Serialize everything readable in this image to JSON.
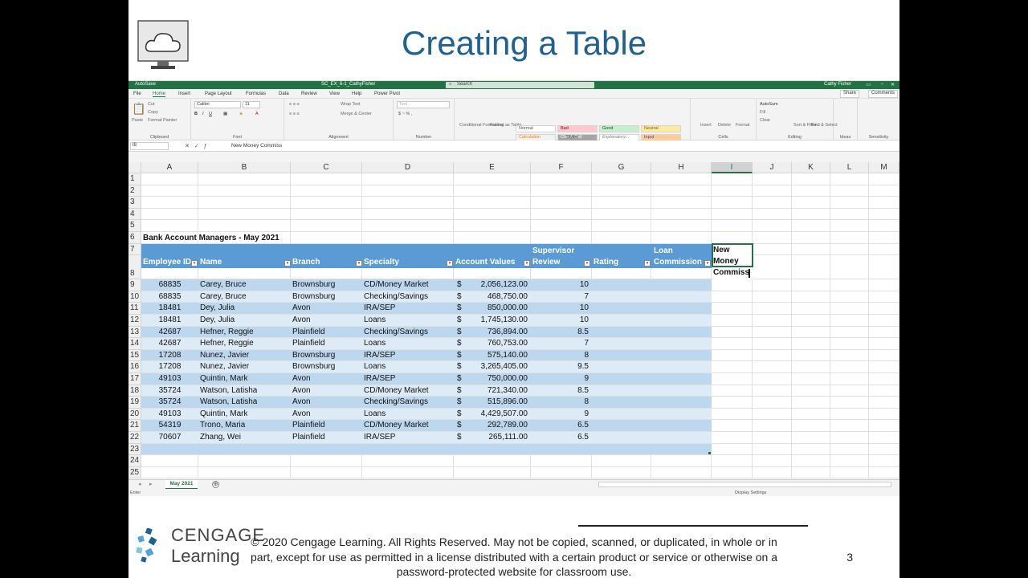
{
  "slide": {
    "title": "Creating a Table",
    "page_number": "3",
    "copyright": "© 2020 Cengage Learning. All Rights Reserved. May not be copied, scanned, or duplicated, in whole or in part, except for use as permitted in a license distributed with a certain product or service or otherwise on a password-protected website for classroom use.",
    "logo_line1": "CENGAGE",
    "logo_line2": "Learning"
  },
  "excel": {
    "titlebar": {
      "autosave": "AutoSave",
      "filename": "SC_EX_6-1_CathyFisher",
      "search": "Search",
      "user": "Cathy Fisher"
    },
    "menu_tabs": [
      "File",
      "Home",
      "Insert",
      "Page Layout",
      "Formulas",
      "Data",
      "Review",
      "View",
      "Help",
      "Power Pivot"
    ],
    "active_tab": "Home",
    "share": "Share",
    "comments": "Comments",
    "ribbon": {
      "clipboard": {
        "label": "Clipboard",
        "paste": "Paste",
        "cut": "Cut",
        "copy": "Copy",
        "format_painter": "Format Painter"
      },
      "font": {
        "label": "Font",
        "font_name": "Calibri",
        "font_size": "11"
      },
      "alignment": {
        "label": "Alignment",
        "wrap_text": "Wrap Text",
        "merge_center": "Merge & Center"
      },
      "number": {
        "label": "Number",
        "format": "Text"
      },
      "styles": {
        "label": "Styles",
        "conditional": "Conditional Formatting",
        "format_as_table": "Format as Table",
        "cell_styles": [
          "Normal",
          "Bad",
          "Good",
          "Neutral",
          "Calculation",
          "Check Cell",
          "Explanatory...",
          "Input"
        ]
      },
      "cells": {
        "label": "Cells",
        "insert": "Insert",
        "delete": "Delete",
        "format": "Format"
      },
      "editing": {
        "label": "Editing",
        "autosum": "AutoSum",
        "fill": "Fill",
        "clear": "Clear",
        "sort_filter": "Sort & Filter",
        "find_select": "Find & Select"
      },
      "ideas": {
        "label": "Ideas"
      },
      "sensitivity": {
        "label": "Sensitivity"
      }
    },
    "name_box": "I8",
    "formula": "New Money Commiss",
    "columns": [
      "A",
      "B",
      "C",
      "D",
      "E",
      "F",
      "G",
      "H",
      "I",
      "J",
      "K",
      "L",
      "M"
    ],
    "rows": [
      "1",
      "2",
      "3",
      "4",
      "5",
      "6",
      "7",
      "8",
      "9",
      "10",
      "11",
      "12",
      "13",
      "14",
      "15",
      "16",
      "17",
      "18",
      "19",
      "20",
      "21",
      "22",
      "23",
      "24",
      "25"
    ],
    "sheet_title": "Bank Account Managers - May 2021",
    "table_headers": {
      "employee_id": "Employee ID",
      "name": "Name",
      "branch": "Branch",
      "specialty": "Specialty",
      "account_values": "Account Values",
      "supervisor_line1": "Supervisor",
      "supervisor_line2": "Review",
      "rating": "Rating",
      "loan_line1": "Loan",
      "loan_line2": "Commission",
      "new_money_line1": "New",
      "new_money_line2": "Money",
      "new_money_line3": "Commiss"
    },
    "table_rows": [
      {
        "id": "68835",
        "name": "Carey, Bruce",
        "branch": "Brownsburg",
        "specialty": "CD/Money Market",
        "dollar": "$",
        "value": "2,056,123.00",
        "review": "10"
      },
      {
        "id": "68835",
        "name": "Carey, Bruce",
        "branch": "Brownsburg",
        "specialty": "Checking/Savings",
        "dollar": "$",
        "value": "468,750.00",
        "review": "7"
      },
      {
        "id": "18481",
        "name": "Dey, Julia",
        "branch": "Avon",
        "specialty": "IRA/SEP",
        "dollar": "$",
        "value": "850,000.00",
        "review": "10"
      },
      {
        "id": "18481",
        "name": "Dey, Julia",
        "branch": "Avon",
        "specialty": "Loans",
        "dollar": "$",
        "value": "1,745,130.00",
        "review": "10"
      },
      {
        "id": "42687",
        "name": "Hefner, Reggie",
        "branch": "Plainfield",
        "specialty": "Checking/Savings",
        "dollar": "$",
        "value": "736,894.00",
        "review": "8.5"
      },
      {
        "id": "42687",
        "name": "Hefner, Reggie",
        "branch": "Plainfield",
        "specialty": "Loans",
        "dollar": "$",
        "value": "760,753.00",
        "review": "7"
      },
      {
        "id": "17208",
        "name": "Nunez, Javier",
        "branch": "Brownsburg",
        "specialty": "IRA/SEP",
        "dollar": "$",
        "value": "575,140.00",
        "review": "8"
      },
      {
        "id": "17208",
        "name": "Nunez, Javier",
        "branch": "Brownsburg",
        "specialty": "Loans",
        "dollar": "$",
        "value": "3,265,405.00",
        "review": "9.5"
      },
      {
        "id": "49103",
        "name": "Quintin, Mark",
        "branch": "Avon",
        "specialty": "IRA/SEP",
        "dollar": "$",
        "value": "750,000.00",
        "review": "9"
      },
      {
        "id": "35724",
        "name": "Watson, Latisha",
        "branch": "Avon",
        "specialty": "CD/Money Market",
        "dollar": "$",
        "value": "721,340.00",
        "review": "8.5"
      },
      {
        "id": "35724",
        "name": "Watson, Latisha",
        "branch": "Avon",
        "specialty": "Checking/Savings",
        "dollar": "$",
        "value": "515,896.00",
        "review": "8"
      },
      {
        "id": "49103",
        "name": "Quintin, Mark",
        "branch": "Avon",
        "specialty": "Loans",
        "dollar": "$",
        "value": "4,429,507.00",
        "review": "9"
      },
      {
        "id": "54319",
        "name": "Trono, Maria",
        "branch": "Plainfield",
        "specialty": "CD/Money Market",
        "dollar": "$",
        "value": "292,789.00",
        "review": "6.5"
      },
      {
        "id": "70607",
        "name": "Zhang, Wei",
        "branch": "Plainfield",
        "specialty": "IRA/SEP",
        "dollar": "$",
        "value": "265,111.00",
        "review": "6.5"
      }
    ],
    "sheet_tab": "May 2021",
    "add_sheet": "⊕",
    "status": "Enter",
    "display_settings": "Display Settings"
  },
  "colors": {
    "accent": "#217346",
    "title": "#1f6191",
    "table_header": "#5b9bd5",
    "band_light": "#ddebf7",
    "band_dark": "#bdd7ee"
  }
}
